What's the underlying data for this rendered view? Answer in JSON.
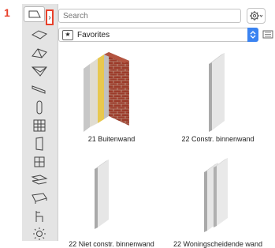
{
  "callout": "1",
  "search": {
    "placeholder": "Search"
  },
  "favorites": {
    "selected": "Favorites"
  },
  "toolbar": {
    "tools": [
      "wall-tool-icon",
      "slab-tool-icon",
      "roof-tool-icon",
      "shell-tool-icon",
      "beam-tool-icon",
      "column-tool-icon",
      "curtain-wall-tool-icon",
      "door-tool-icon",
      "window-tool-icon",
      "stair-tool-icon",
      "railing-tool-icon",
      "object-tool-icon",
      "lamp-tool-icon"
    ]
  },
  "items": [
    {
      "label": "21 Buitenwand",
      "kind": "brick"
    },
    {
      "label": "22 Constr. binnenwand",
      "kind": "single"
    },
    {
      "label": "22 Niet constr. binnenwand",
      "kind": "single"
    },
    {
      "label": "22 Woningscheidende wand",
      "kind": "double"
    }
  ],
  "colors": {
    "accent": "#3a83f1",
    "callout": "#e8402a"
  }
}
